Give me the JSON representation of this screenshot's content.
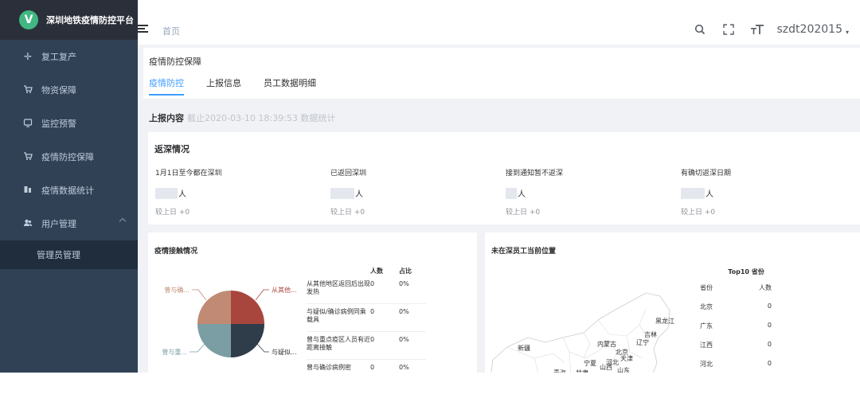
{
  "app": {
    "title": "深圳地铁疫情防控平台",
    "logo_letter": "V"
  },
  "sidebar": {
    "items": [
      {
        "label": "复工复产",
        "icon": "move-icon"
      },
      {
        "label": "物资保障",
        "icon": "cart-icon"
      },
      {
        "label": "监控预警",
        "icon": "monitor-icon"
      },
      {
        "label": "疫情防控保障",
        "icon": "cart-icon"
      },
      {
        "label": "疫情数据统计",
        "icon": "chart-icon"
      },
      {
        "label": "用户管理",
        "icon": "user-group-icon"
      }
    ],
    "submenu": [
      {
        "label": "管理员管理"
      }
    ]
  },
  "navbar": {
    "breadcrumb": "首页",
    "username": "szdt202015"
  },
  "page": {
    "title": "疫情防控保障",
    "tabs": [
      {
        "label": "疫情防控",
        "active": true
      },
      {
        "label": "上报信息",
        "active": false
      },
      {
        "label": "员工数据明细",
        "active": false
      }
    ],
    "report": {
      "label": "上报内容",
      "meta": "截止2020-03-10 18:39:53 数据统计"
    }
  },
  "return_card": {
    "title": "返深情况",
    "stats": [
      {
        "label": "1月1日至今都在深圳",
        "unit": "人",
        "compare": "较上日 +0"
      },
      {
        "label": "已返回深圳",
        "unit": "人",
        "compare": "较上日 +0"
      },
      {
        "label": "接到通知暂不返深",
        "unit": "人",
        "compare": "较上日 +0"
      },
      {
        "label": "有确切返深日期",
        "unit": "人",
        "compare": "较上日 +0"
      }
    ]
  },
  "contact_card": {
    "title": "疫情接触情况",
    "pie_labels": [
      "从其他...",
      "与疑似...",
      "曾与重...",
      "曾与确..."
    ],
    "table_headers": {
      "count": "人数",
      "ratio": "占比"
    },
    "rows": [
      {
        "name": "从其他地区返回后出现发热",
        "count": "0",
        "ratio": "0%"
      },
      {
        "name": "与疑似/确诊病例同乘载具",
        "count": "0",
        "ratio": "0%"
      },
      {
        "name": "曾与重点疫区人员有近距离接触",
        "count": "0",
        "ratio": "0%"
      },
      {
        "name": "曾与确诊病例密",
        "count": "0",
        "ratio": "0%"
      }
    ]
  },
  "location_card": {
    "title": "未在深员工当前位置",
    "map_labels": [
      "黑龙江",
      "吉林",
      "辽宁",
      "内蒙古",
      "北京",
      "天津",
      "河北",
      "新疆",
      "宁夏",
      "山西",
      "山东",
      "青海",
      "甘肃"
    ],
    "top10": {
      "title": "Top10 省份",
      "headers": {
        "province": "省份",
        "count": "人数"
      },
      "rows": [
        {
          "province": "北京",
          "count": "0"
        },
        {
          "province": "广东",
          "count": "0"
        },
        {
          "province": "江西",
          "count": "0"
        },
        {
          "province": "河北",
          "count": "0"
        }
      ]
    }
  },
  "colors": {
    "sidebar_bg": "#304156",
    "accent": "#409eff",
    "pie": [
      "#a8453c",
      "#2f3c4a",
      "#7a9ea3",
      "#c08a74"
    ]
  }
}
